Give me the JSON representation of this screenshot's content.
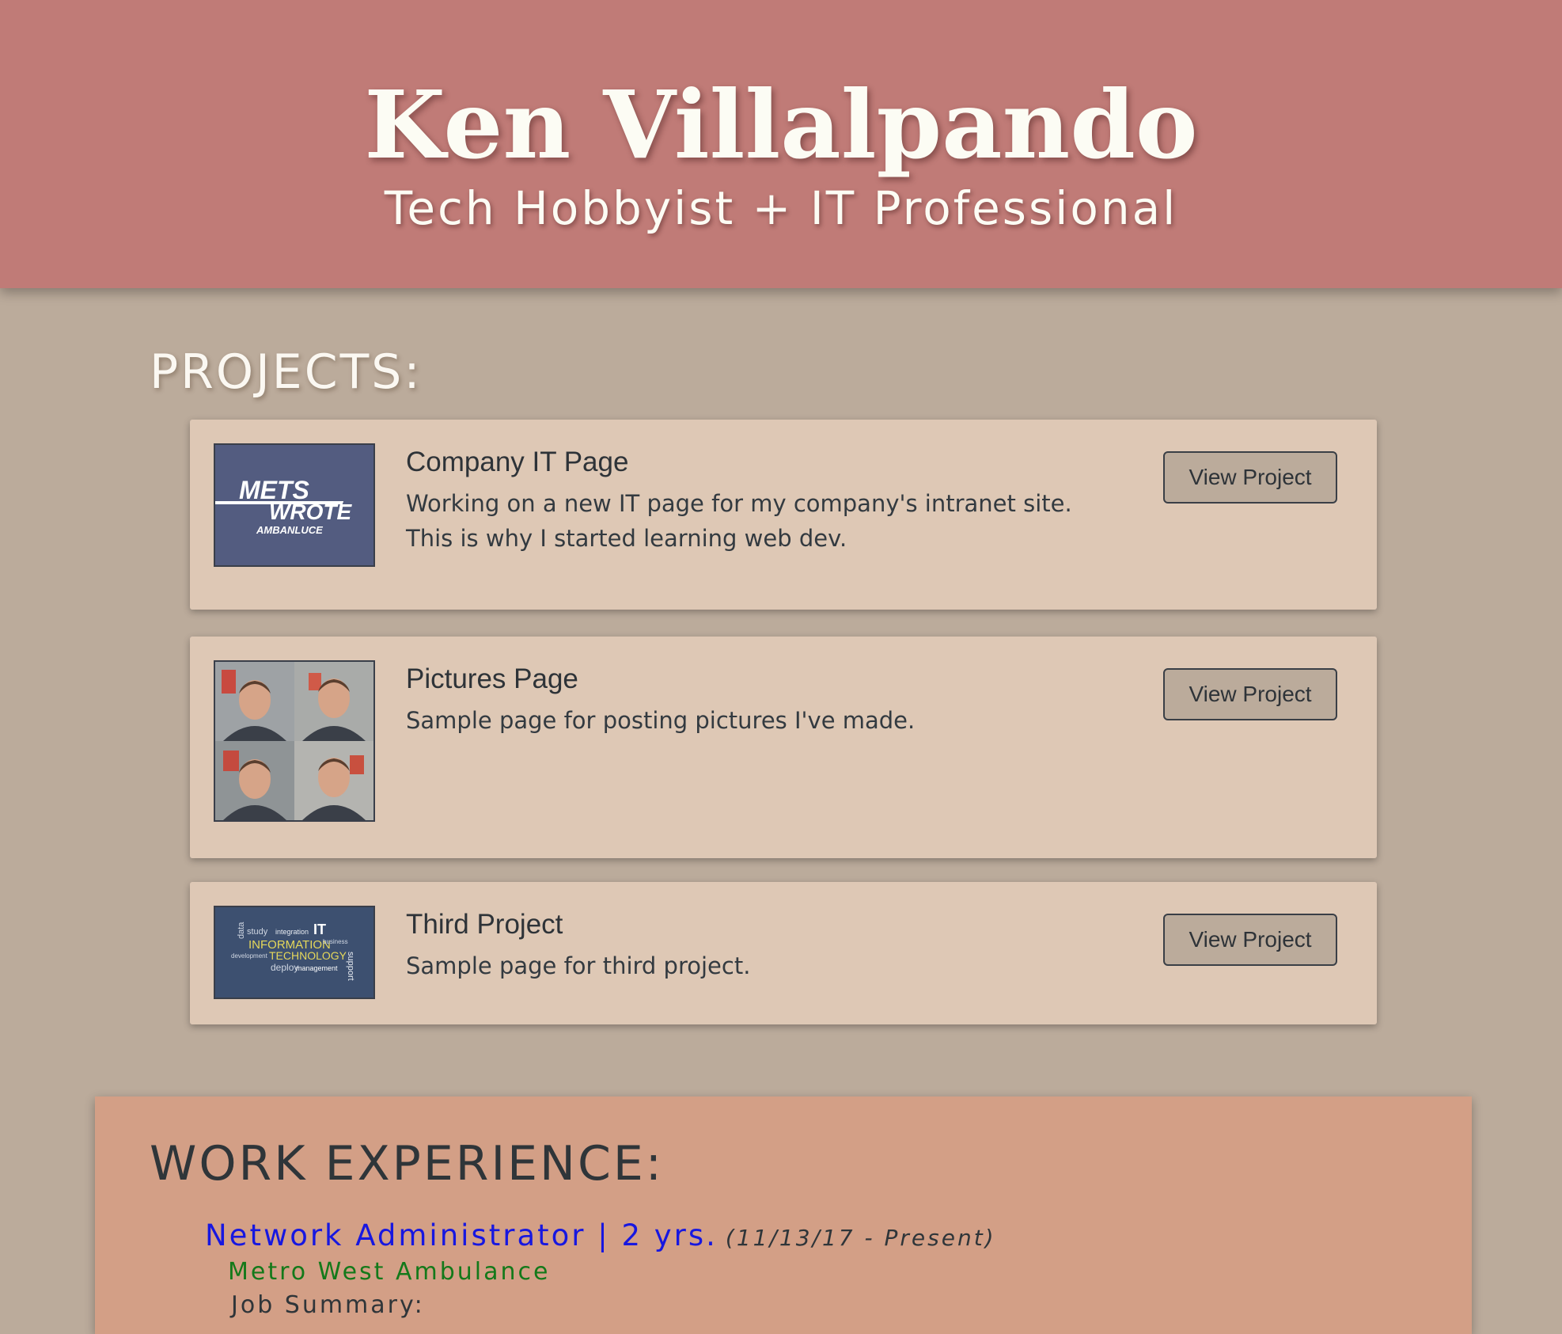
{
  "header": {
    "name": "Ken Villalpando",
    "tagline": "Tech Hobbyist + IT Professional"
  },
  "projects": {
    "heading": "PROJECTS:",
    "items": [
      {
        "title": "Company IT Page",
        "description": "Working on a new IT page for my company's intranet site. This is why I started learning web dev.",
        "button": "View Project",
        "thumbnail": {
          "line1": "METS",
          "line2": "WROTE",
          "line3": "AMBANLUCE"
        }
      },
      {
        "title": "Pictures Page",
        "description": "Sample page for posting pictures I've made.",
        "button": "View Project"
      },
      {
        "title": "Third Project",
        "description": "Sample page for third project.",
        "button": "View Project",
        "thumbnail": {
          "words": [
            "data",
            "study",
            "integration",
            "IT",
            "INFORMATION",
            "TECHNOLOGY",
            "development",
            "deploy",
            "management",
            "support",
            "business"
          ]
        }
      }
    ]
  },
  "work": {
    "heading": "WORK EXPERIENCE:",
    "job": {
      "title": "Network Administrator | 2 yrs.",
      "dates": "(11/13/17 - Present)",
      "company": "Metro West Ambulance",
      "summary_label": "Job Summary:"
    }
  },
  "colors": {
    "header_bg": "#c07b77",
    "page_bg": "#bbab9b",
    "card_bg": "#dec8b5",
    "work_bg": "#d39f86",
    "job_title": "#1717e0",
    "company": "#14791a"
  }
}
